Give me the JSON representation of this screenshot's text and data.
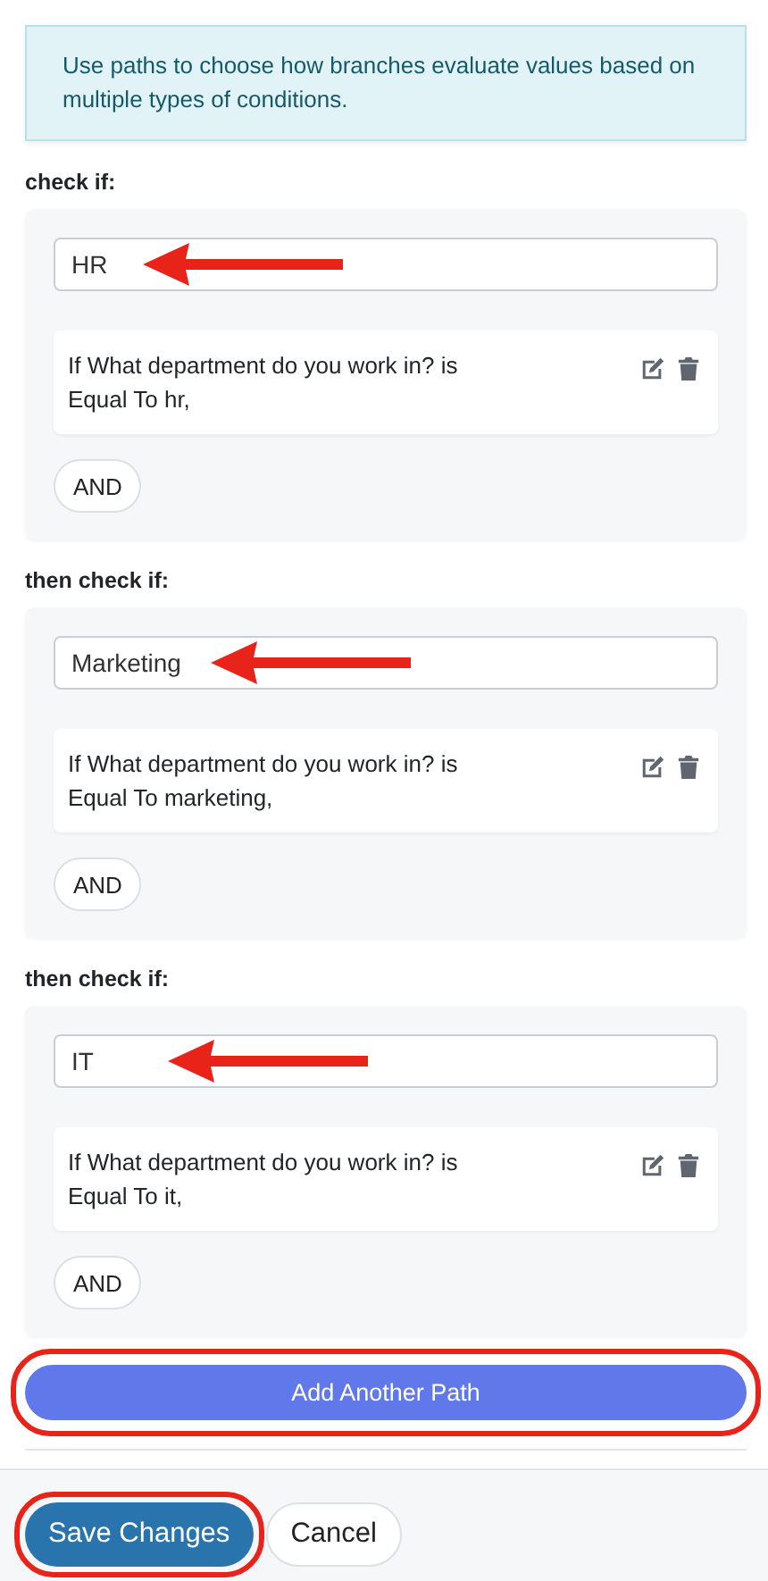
{
  "info": "Use paths to choose how branches evaluate values based on multiple types of conditions.",
  "paths": [
    {
      "label": "check if:",
      "name": "HR",
      "conditions": [
        "If What department do you work in? is Equal To hr,"
      ],
      "and_button": "AND"
    },
    {
      "label": "then check if:",
      "name": "Marketing",
      "conditions": [
        "If What department do you work in? is Equal To marketing,"
      ],
      "and_button": "AND"
    },
    {
      "label": "then check if:",
      "name": "IT",
      "conditions": [
        "If What department do you work in? is Equal To it,"
      ],
      "and_button": "AND"
    }
  ],
  "add_button": "Add Another Path",
  "footer_buttons": [
    {
      "label": "Save Changes",
      "kind": "primary"
    },
    {
      "label": "Cancel",
      "kind": "secondary"
    }
  ]
}
